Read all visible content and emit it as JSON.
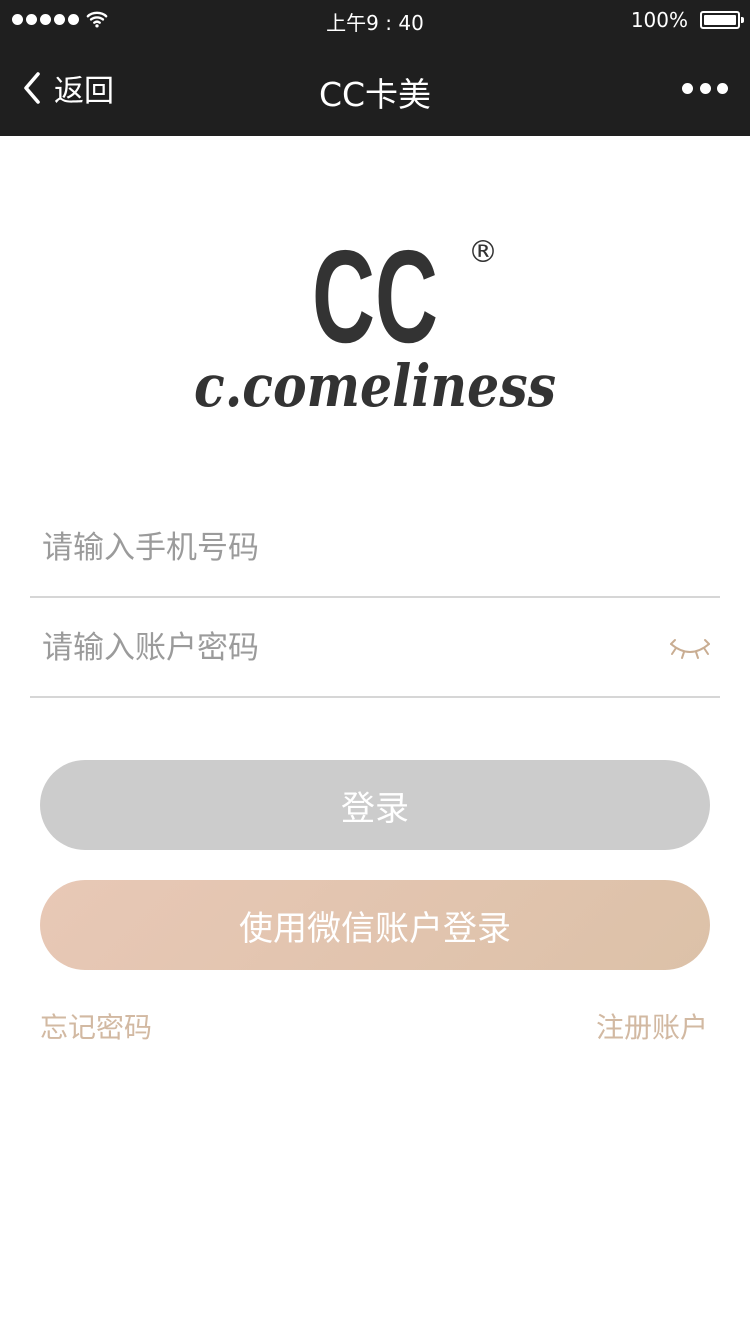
{
  "status_bar": {
    "time": "上午9 : 40",
    "battery": "100%",
    "icons": [
      "signal-dots",
      "wifi-icon",
      "battery-icon"
    ]
  },
  "nav": {
    "back_label": "返回",
    "title": "CC卡美",
    "more_icon": "more-dots-icon"
  },
  "logo": {
    "mark": "CC",
    "registered": "®",
    "wordmark": "c.comeliness"
  },
  "form": {
    "phone_placeholder": "请输入手机号码",
    "phone_value": "",
    "password_placeholder": "请输入账户密码",
    "password_value": "",
    "password_toggle_icon": "closed-eye-icon"
  },
  "actions": {
    "login_label": "登录",
    "wechat_login_label": "使用微信账户登录",
    "forgot_label": "忘记密码",
    "register_label": "注册账户"
  },
  "colors": {
    "bar_bg": "#1f1f1f",
    "login_disabled": "#cccccc",
    "wechat_gradient_start": "#e8c8b6",
    "wechat_gradient_end": "#dcc1a8",
    "accent_text": "#d2b9a2"
  }
}
